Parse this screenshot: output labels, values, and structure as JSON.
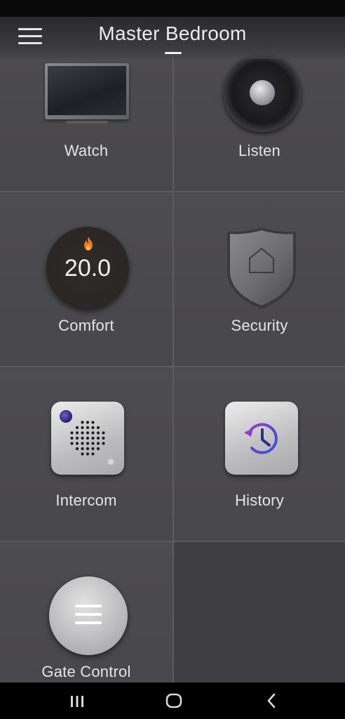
{
  "header": {
    "title": "Master Bedroom"
  },
  "tiles": {
    "watch": {
      "label": "Watch"
    },
    "listen": {
      "label": "Listen"
    },
    "comfort": {
      "label": "Comfort",
      "temperature": "20.0"
    },
    "security": {
      "label": "Security"
    },
    "intercom": {
      "label": "Intercom"
    },
    "history": {
      "label": "History"
    },
    "gate": {
      "label": "Gate Control"
    }
  },
  "icons": {
    "menu": "hamburger-menu-icon",
    "watch": "tv-icon",
    "listen": "speaker-icon",
    "comfort": "thermostat-dial-icon",
    "comfort_mode": "flame-icon",
    "security": "shield-home-icon",
    "intercom": "intercom-speaker-icon",
    "history": "history-clock-icon",
    "gate": "menu-lines-icon",
    "nav_recents": "recent-apps-icon",
    "nav_home": "home-icon",
    "nav_back": "back-icon"
  },
  "colors": {
    "background": "#4b4a4e",
    "header": "#2b2a2e",
    "accent_heat": "#f07a1a",
    "history_accent": "#5a4fcf"
  }
}
